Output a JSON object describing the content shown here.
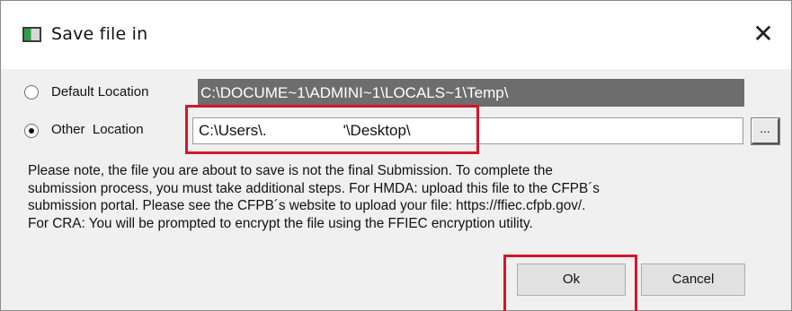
{
  "window": {
    "title": "Save file in",
    "close_glyph": "✕",
    "icon": "app-window-icon"
  },
  "options": {
    "default_label": "Default Location",
    "default_path": "C:\\DOCUME~1\\ADMINI~1\\LOCALS~1\\Temp\\",
    "default_selected": false,
    "other_label": "Other  Location",
    "other_path": "C:\\Users\\.                  '\\Desktop\\",
    "other_selected": true,
    "browse_label": "..."
  },
  "note": {
    "lines": [
      "Please note, the file you are about to save is not the final Submission. To complete the",
      "submission process, you must take additional steps. For HMDA: upload this file to the CFPB´s",
      "submission portal. Please see the CFPB´s website to upload your file: https://ffiec.cfpb.gov/.",
      "For CRA: You will be prompted to encrypt the file using the FFIEC encryption utility."
    ]
  },
  "buttons": {
    "ok": "Ok",
    "cancel": "Cancel"
  },
  "colors": {
    "highlight": "#d4162a",
    "disabled_path_bg": "#6d6d6d",
    "dialog_bg": "#f0f0f0"
  }
}
